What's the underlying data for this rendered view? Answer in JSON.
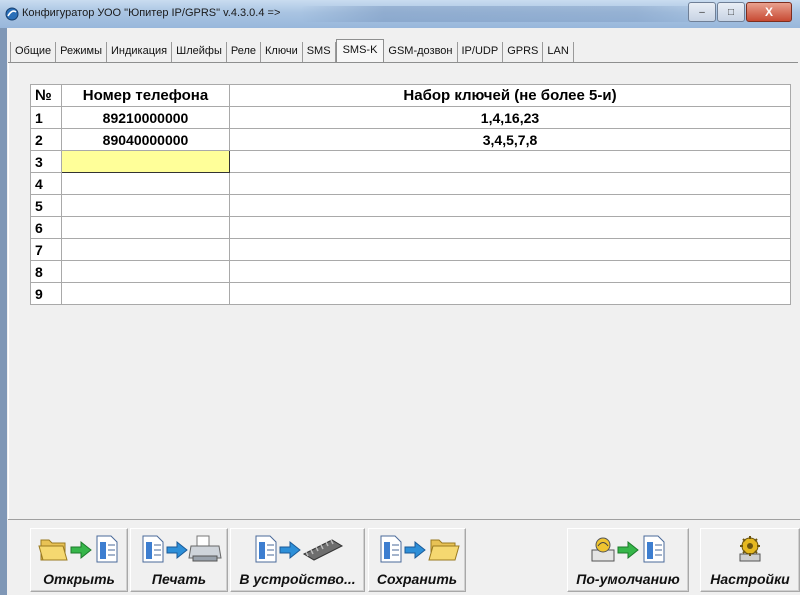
{
  "window": {
    "title": "Конфигуратор УОО \"Юпитер IP/GPRS\" v.4.3.0.4  =>",
    "minimize": "–",
    "maximize": "□",
    "close": "X"
  },
  "tabs": [
    {
      "label": "Общие"
    },
    {
      "label": "Режимы"
    },
    {
      "label": "Индикация"
    },
    {
      "label": "Шлейфы"
    },
    {
      "label": "Реле"
    },
    {
      "label": "Ключи"
    },
    {
      "label": "SMS"
    },
    {
      "label": "SMS-K"
    },
    {
      "label": "GSM-дозвон"
    },
    {
      "label": "IP/UDP"
    },
    {
      "label": "GPRS"
    },
    {
      "label": "LAN"
    }
  ],
  "active_tab": "SMS-K",
  "table": {
    "headers": {
      "num": "№",
      "phone": "Номер телефона",
      "keys": "Набор ключей (не более 5-и)"
    },
    "rows": [
      {
        "num": "1",
        "phone": "89210000000",
        "keys": "1,4,16,23"
      },
      {
        "num": "2",
        "phone": "89040000000",
        "keys": "3,4,5,7,8"
      },
      {
        "num": "3",
        "phone": "",
        "keys": ""
      },
      {
        "num": "4",
        "phone": "",
        "keys": ""
      },
      {
        "num": "5",
        "phone": "",
        "keys": ""
      },
      {
        "num": "6",
        "phone": "",
        "keys": ""
      },
      {
        "num": "7",
        "phone": "",
        "keys": ""
      },
      {
        "num": "8",
        "phone": "",
        "keys": ""
      },
      {
        "num": "9",
        "phone": "",
        "keys": ""
      }
    ],
    "selected_cell_color": "#ffff99"
  },
  "toolbar": {
    "open": "Открыть",
    "print": "Печать",
    "to_device": "В устройство...",
    "save": "Сохранить",
    "defaults": "По-умолчанию",
    "settings": "Настройки"
  },
  "icons": {
    "open": [
      "folder-icon",
      "arrow-right-icon",
      "document-icon"
    ],
    "print": [
      "document-icon",
      "arrow-right-icon",
      "printer-icon"
    ],
    "to_device": [
      "document-icon",
      "arrow-right-icon",
      "chip-icon"
    ],
    "save": [
      "document-icon",
      "arrow-right-icon",
      "folder-icon"
    ],
    "defaults": [
      "device-icon",
      "arrow-right-icon",
      "document-icon"
    ],
    "settings": [
      "gear-icon"
    ]
  }
}
